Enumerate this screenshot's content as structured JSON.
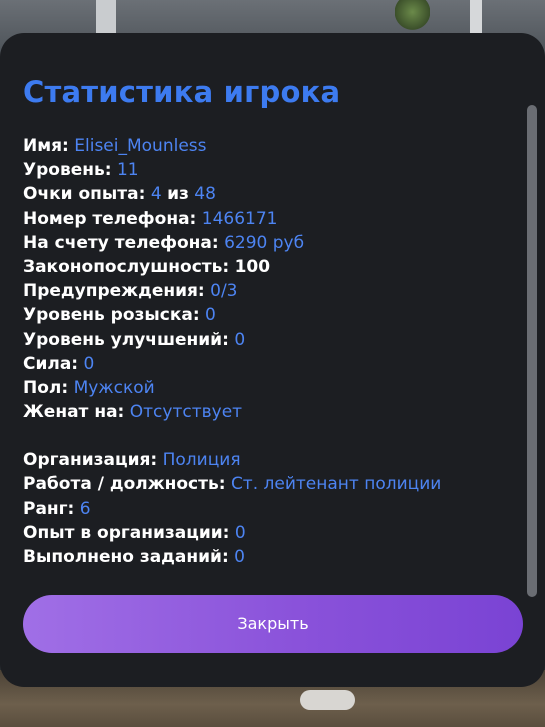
{
  "panel": {
    "title": "Статистика игрока",
    "close_label": "Закрыть"
  },
  "stats": [
    {
      "label": "Имя:",
      "value": "Elisei_Mounless"
    },
    {
      "label": "Уровень:",
      "value": "11"
    },
    {
      "label": "Очки опыта:",
      "value": "4",
      "mid": "из",
      "value2": "48"
    },
    {
      "label": "Номер телефона:",
      "value": "1466171"
    },
    {
      "label": "На счету телефона:",
      "value": "6290 руб"
    },
    {
      "label": "Законопослушность:",
      "value": "100",
      "value_color": "white"
    },
    {
      "label": "Предупреждения:",
      "value": "0/3"
    },
    {
      "label": "Уровень розыска:",
      "value": "0"
    },
    {
      "label": "Уровень улучшений:",
      "value": "0"
    },
    {
      "label": "Сила:",
      "value": "0"
    },
    {
      "label": "Пол:",
      "value": "Мужской"
    },
    {
      "label": "Женат на:",
      "value": "Отсутствует"
    }
  ],
  "org_stats": [
    {
      "label": "Организация:",
      "value": "Полиция"
    },
    {
      "label": "Работа / должность:",
      "value": "Ст. лейтенант полиции"
    },
    {
      "label": "Ранг:",
      "value": "6"
    },
    {
      "label": "Опыт в организации:",
      "value": "0"
    },
    {
      "label": "Выполнено заданий:",
      "value": "0"
    }
  ],
  "colors": {
    "panel_bg": "#1c1e22",
    "accent_blue": "#3d7bf0",
    "value_blue": "#4d84f2",
    "button_purple": "#8a52da"
  }
}
